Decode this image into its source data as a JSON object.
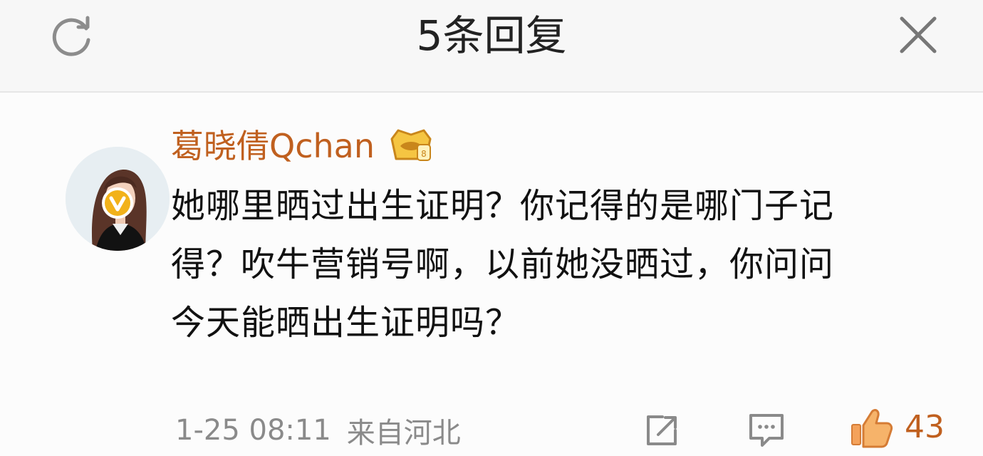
{
  "header": {
    "title": "5条回复",
    "refresh_icon": "refresh-icon",
    "close_icon": "close-icon"
  },
  "comment": {
    "username": "葛晓倩Qchan",
    "verified_icon": "verified-v-icon",
    "badge_icon": "crown-badge-icon",
    "text_lines": [
      "她哪里晒过出生证明？你记得的是哪门子记",
      "得？吹牛营销号啊，以前她没晒过，你问问",
      "今天能晒出生证明吗？"
    ],
    "timestamp": "1-25 08:11",
    "source": "来自河北",
    "actions": {
      "repost_icon": "repost-icon",
      "reply_icon": "comment-icon",
      "like_icon": "thumbs-up-icon",
      "like_count": "43"
    }
  },
  "colors": {
    "accent": "#c0601f",
    "verified": "#f2b21a",
    "text": "#111111",
    "muted": "#8a8a8a"
  }
}
